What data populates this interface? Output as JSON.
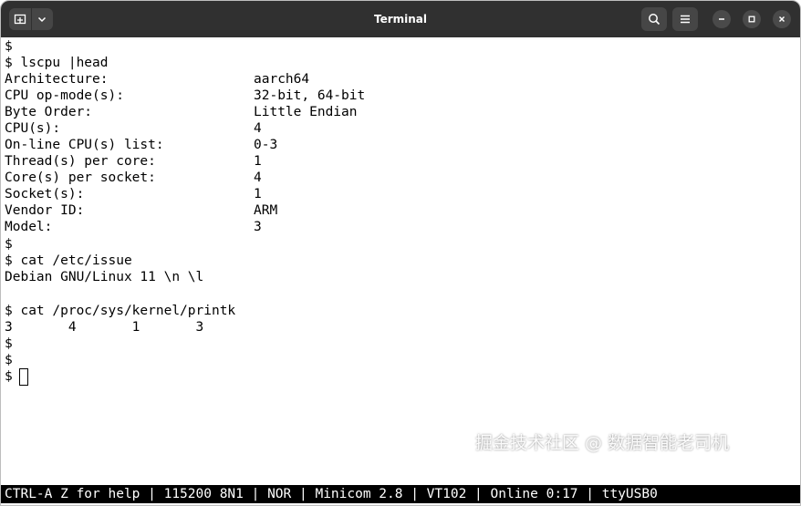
{
  "window": {
    "title": "Terminal"
  },
  "icons": {
    "new_tab": "new-tab-icon",
    "menu_dropdown": "chevron-down-icon",
    "search": "search-icon",
    "hamburger": "hamburger-menu-icon",
    "minimize": "minimize-icon",
    "maximize": "maximize-icon",
    "close": "close-icon"
  },
  "terminal": {
    "lines": [
      {
        "text": "$"
      },
      {
        "text": "$ lscpu |head"
      },
      {
        "text": "Architecture:",
        "value": "aarch64"
      },
      {
        "text": "CPU op-mode(s):",
        "value": "32-bit, 64-bit"
      },
      {
        "text": "Byte Order:",
        "value": "Little Endian"
      },
      {
        "text": "CPU(s):",
        "value": "4"
      },
      {
        "text": "On-line CPU(s) list:",
        "value": "0-3"
      },
      {
        "text": "Thread(s) per core:",
        "value": "1"
      },
      {
        "text": "Core(s) per socket:",
        "value": "4"
      },
      {
        "text": "Socket(s):",
        "value": "1"
      },
      {
        "text": "Vendor ID:",
        "value": "ARM"
      },
      {
        "text": "Model:",
        "value": "3"
      },
      {
        "text": "$"
      },
      {
        "text": "$ cat /etc/issue"
      },
      {
        "text": "Debian GNU/Linux 11 \\n \\l"
      },
      {
        "text": ""
      },
      {
        "text": "$ cat /proc/sys/kernel/printk"
      },
      {
        "text": "3       4       1       3"
      },
      {
        "text": "$"
      },
      {
        "text": "$"
      },
      {
        "text": "$ "
      }
    ]
  },
  "status_bar": {
    "text": "CTRL-A Z for help | 115200 8N1 | NOR | Minicom 2.8 | VT102 | Online 0:17 | ttyUSB0"
  },
  "watermark": {
    "text": "掘金技术社区 @ 数据智能老司机"
  }
}
